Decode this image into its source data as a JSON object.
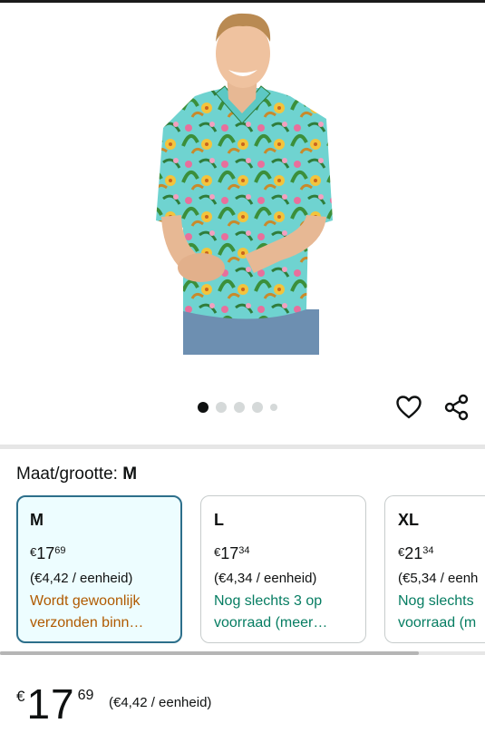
{
  "gallery": {
    "image_alt": "Man in Hawaiian floral shirt",
    "dot_count": 5,
    "active_dot": 0
  },
  "actions": {
    "wishlist_icon": "heart-icon",
    "share_icon": "share-icon"
  },
  "size_selector": {
    "label": "Maat/grootte:",
    "selected": "M"
  },
  "variants": [
    {
      "size": "M",
      "price_currency": "€",
      "price_whole": "17",
      "price_fraction": "69",
      "unit_price": "(€4,42 / eenheid)",
      "availability": "Wordt gewoonlijk",
      "availability_line2": "verzonden binn…",
      "availability_color": "#b05a00",
      "selected": true
    },
    {
      "size": "L",
      "price_currency": "€",
      "price_whole": "17",
      "price_fraction": "34",
      "unit_price": "(€4,34 / eenheid)",
      "availability": "Nog slechts 3 op",
      "availability_line2": "voorraad (meer…",
      "availability_color": "#067d62",
      "selected": false
    },
    {
      "size": "XL",
      "price_currency": "€",
      "price_whole": "21",
      "price_fraction": "34",
      "unit_price": "(€5,34 / eenh",
      "availability": "Nog slechts",
      "availability_line2": "voorraad (m",
      "availability_color": "#067d62",
      "selected": false
    }
  ],
  "main_price": {
    "currency": "€",
    "whole": "17",
    "fraction": "69",
    "unit_price": "(€4,42 / eenheid)"
  },
  "colors": {
    "selected_border": "#2d6f8b",
    "selected_bg": "#edfdff",
    "orange": "#b05a00",
    "green": "#067d62"
  }
}
